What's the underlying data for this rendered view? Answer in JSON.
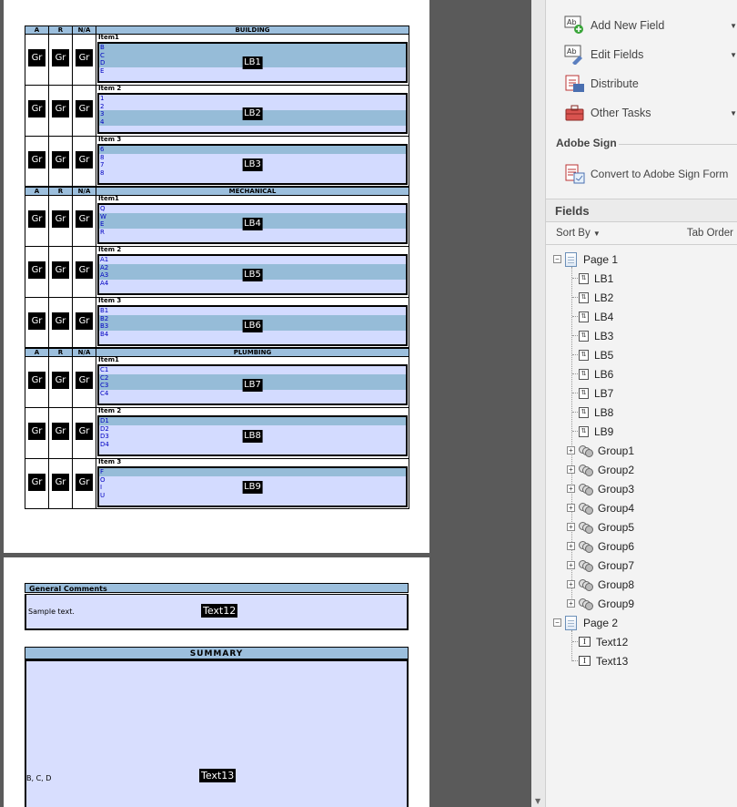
{
  "document": {
    "sections": [
      {
        "columns": [
          "A",
          "R",
          "N/A"
        ],
        "title": "BUILDING",
        "rows": [
          {
            "item": "Item1",
            "lb": "LB1",
            "options": [
              "B",
              "C",
              "D",
              "E"
            ],
            "selected": [
              0,
              1,
              2
            ]
          },
          {
            "item": "Item 2",
            "lb": "LB2",
            "options": [
              "1",
              "2",
              "3",
              "4"
            ],
            "selected": [
              2,
              3
            ]
          },
          {
            "item": "Item 3",
            "lb": "LB3",
            "options": [
              "6",
              "8",
              "7",
              "8"
            ],
            "selected": [
              0
            ]
          }
        ]
      },
      {
        "columns": [
          "A",
          "R",
          "N/A"
        ],
        "title": "MECHANICAL",
        "rows": [
          {
            "item": "Item1",
            "lb": "LB4",
            "options": [
              "Q",
              "W",
              "E",
              "R"
            ],
            "selected": [
              1,
              2
            ]
          },
          {
            "item": "Item 2",
            "lb": "LB5",
            "options": [
              "A1",
              "A2",
              "A3",
              "A4"
            ],
            "selected": [
              1,
              2
            ]
          },
          {
            "item": "Item 3",
            "lb": "LB6",
            "options": [
              "B1",
              "B2",
              "B3",
              "B4"
            ],
            "selected": [
              1,
              2
            ]
          }
        ]
      },
      {
        "columns": [
          "A",
          "R",
          "N/A"
        ],
        "title": "PLUMBING",
        "rows": [
          {
            "item": "Item1",
            "lb": "LB7",
            "options": [
              "C1",
              "C2",
              "C3",
              "C4"
            ],
            "selected": [
              1,
              2
            ]
          },
          {
            "item": "Item 2",
            "lb": "LB8",
            "options": [
              "D1",
              "D2",
              "D3",
              "D4"
            ],
            "selected": [
              0
            ]
          },
          {
            "item": "Item 3",
            "lb": "LB9",
            "options": [
              "F",
              "O",
              "I",
              "U"
            ],
            "selected": [
              0
            ]
          }
        ]
      }
    ],
    "group_button_label": "Gr",
    "comments": {
      "title": "General Comments",
      "value": "Sample text.",
      "field": "Text12"
    },
    "summary": {
      "title": "SUMMARY",
      "value": "B, C, D",
      "field": "Text13"
    }
  },
  "panel": {
    "tools": [
      {
        "label": "Add New Field",
        "icon": "add-field-icon",
        "caret": "▼"
      },
      {
        "label": "Edit Fields",
        "icon": "edit-fields-icon",
        "caret": "▼"
      },
      {
        "label": "Distribute",
        "icon": "distribute-icon",
        "caret": ""
      },
      {
        "label": "Other Tasks",
        "icon": "toolbox-icon",
        "caret": "▼"
      }
    ],
    "adobe_sign": {
      "title": "Adobe Sign",
      "convert_label": "Convert to Adobe Sign Form"
    },
    "fields": {
      "title": "Fields",
      "sort_by": "Sort By",
      "tab_order": "Tab Order",
      "page1": {
        "label": "Page 1",
        "items": [
          "LB1",
          "LB2",
          "LB4",
          "LB3",
          "LB5",
          "LB6",
          "LB7",
          "LB8",
          "LB9"
        ],
        "groups": [
          "Group1",
          "Group2",
          "Group3",
          "Group4",
          "Group5",
          "Group6",
          "Group7",
          "Group8",
          "Group9"
        ]
      },
      "page2": {
        "label": "Page 2",
        "items": [
          "Text12",
          "Text13"
        ]
      }
    }
  }
}
